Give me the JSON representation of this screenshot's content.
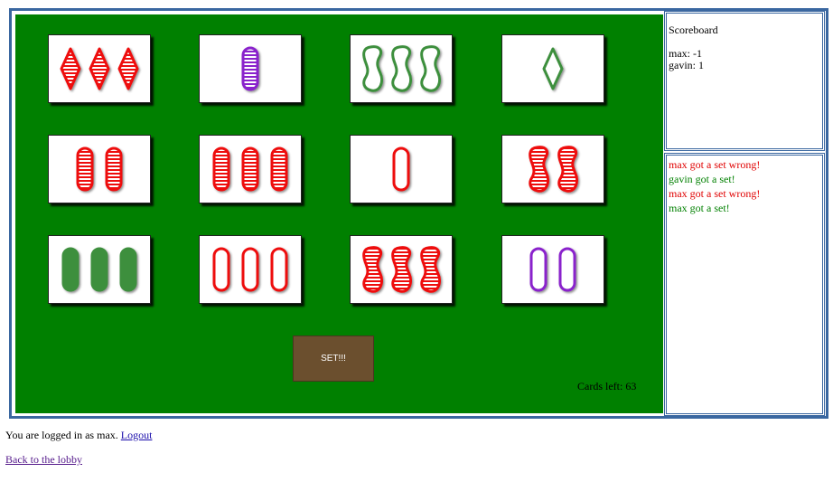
{
  "board": {
    "background_color": "#008000",
    "set_button_label": "SET!!!",
    "cards_left_text": "Cards left: 63",
    "cards": [
      {
        "number": 3,
        "shape": "diamond",
        "color": "#ee1111",
        "fill": "striped"
      },
      {
        "number": 1,
        "shape": "oval",
        "color": "#8a22cc",
        "fill": "striped"
      },
      {
        "number": 3,
        "shape": "squiggle",
        "color": "#3d8f3d",
        "fill": "outline"
      },
      {
        "number": 1,
        "shape": "diamond",
        "color": "#3d8f3d",
        "fill": "outline"
      },
      {
        "number": 2,
        "shape": "oval",
        "color": "#ee1111",
        "fill": "striped"
      },
      {
        "number": 3,
        "shape": "oval",
        "color": "#ee1111",
        "fill": "striped"
      },
      {
        "number": 1,
        "shape": "oval",
        "color": "#ee1111",
        "fill": "outline"
      },
      {
        "number": 2,
        "shape": "squiggle",
        "color": "#ee1111",
        "fill": "striped"
      },
      {
        "number": 3,
        "shape": "oval",
        "color": "#3d8f3d",
        "fill": "solid"
      },
      {
        "number": 3,
        "shape": "oval",
        "color": "#ee1111",
        "fill": "outline"
      },
      {
        "number": 3,
        "shape": "squiggle",
        "color": "#ee1111",
        "fill": "striped"
      },
      {
        "number": 2,
        "shape": "oval",
        "color": "#8a22cc",
        "fill": "outline"
      }
    ]
  },
  "scoreboard": {
    "title": "Scoreboard",
    "scores": [
      "max: -1",
      "gavin: 1"
    ]
  },
  "log": {
    "wrong_color": "#e00000",
    "right_color": "#008000",
    "entries": [
      {
        "text": "max got a set wrong!",
        "status": "wrong"
      },
      {
        "text": "gavin got a set!",
        "status": "right"
      },
      {
        "text": "max got a set wrong!",
        "status": "wrong"
      },
      {
        "text": "max got a set!",
        "status": "right"
      }
    ]
  },
  "footer": {
    "logged_in_text": "You are logged in as max.",
    "logout_label": "Logout",
    "lobby_label": "Back to the lobby"
  }
}
